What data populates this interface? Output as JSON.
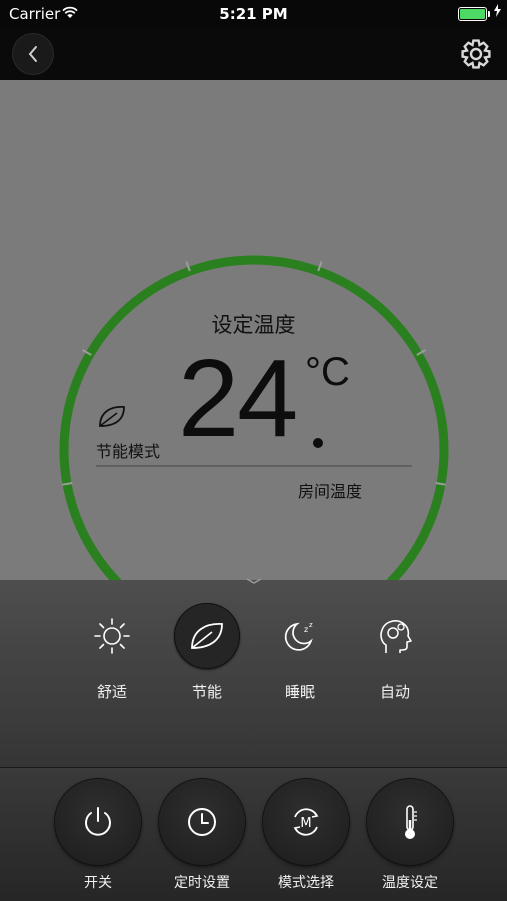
{
  "status_bar": {
    "carrier": "Carrier",
    "time": "5:21 PM"
  },
  "nav": {
    "back_icon": "chevron-left-icon",
    "settings_icon": "gear-icon"
  },
  "thermostat": {
    "set_label": "设定温度",
    "temperature": "24",
    "unit": "°C",
    "mode_label": "节能模式",
    "room_label": "房间温度",
    "ring_color": "#2a7f1f"
  },
  "modes": [
    {
      "label": "舒适",
      "icon": "sun-icon",
      "active": false
    },
    {
      "label": "节能",
      "icon": "leaf-icon",
      "active": true
    },
    {
      "label": "睡眠",
      "icon": "moon-sleep-icon",
      "active": false
    },
    {
      "label": "自动",
      "icon": "head-gear-icon",
      "active": false
    }
  ],
  "controls": [
    {
      "label": "开关",
      "icon": "power-icon"
    },
    {
      "label": "定时设置",
      "icon": "clock-icon"
    },
    {
      "label": "模式选择",
      "icon": "mode-cycle-icon"
    },
    {
      "label": "温度设定",
      "icon": "thermometer-icon"
    }
  ]
}
